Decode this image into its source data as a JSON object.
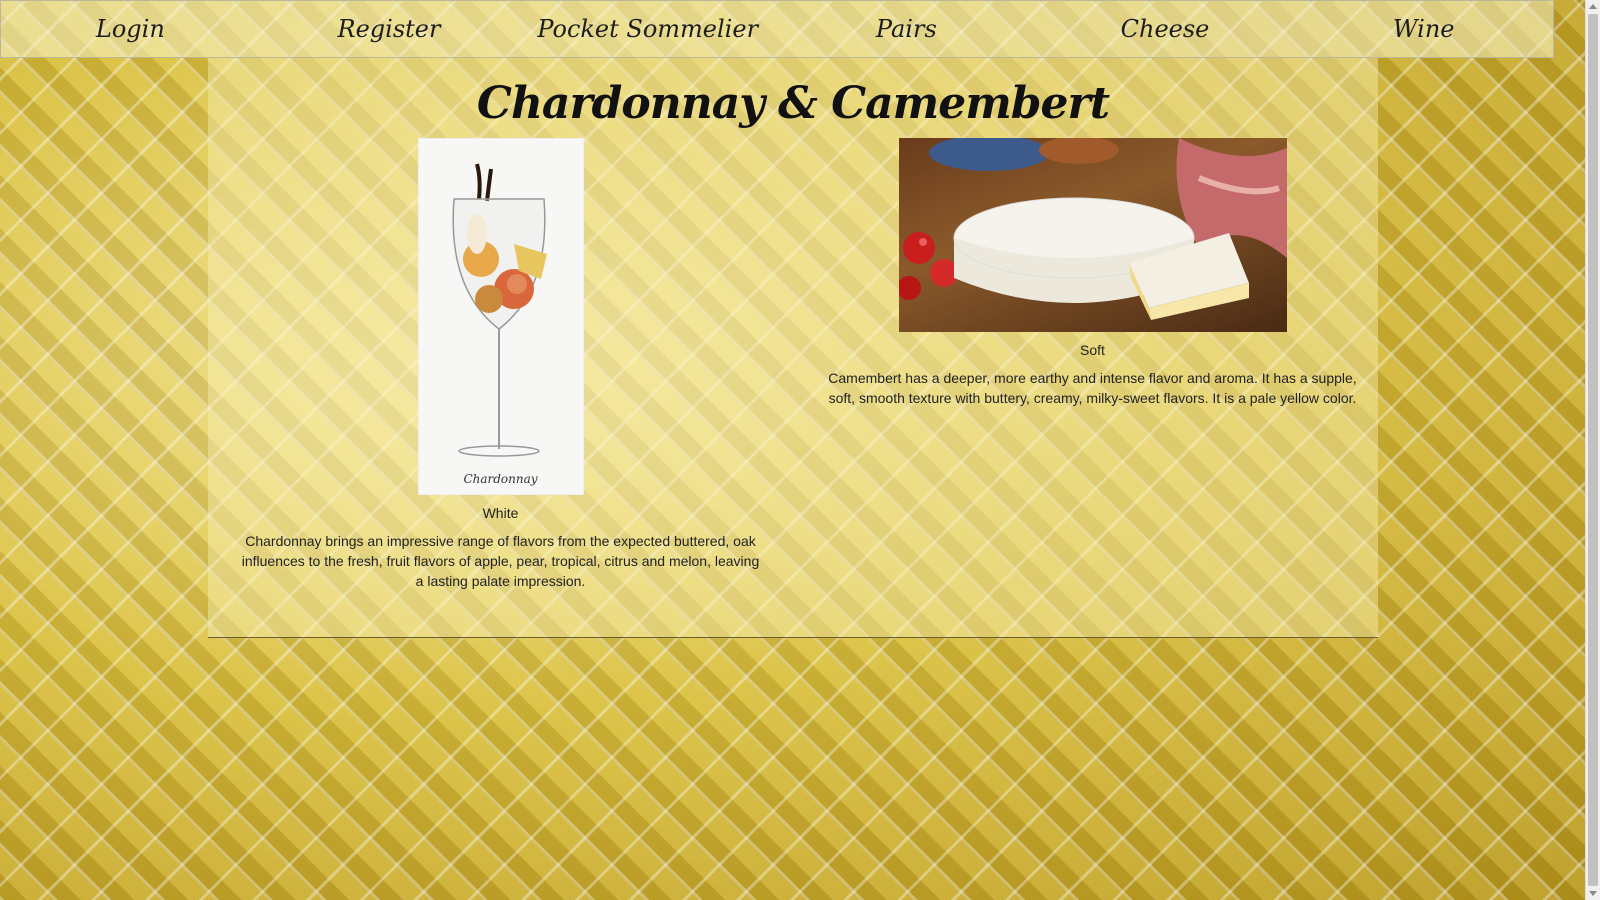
{
  "nav": {
    "items": [
      {
        "label": "Login"
      },
      {
        "label": "Register"
      },
      {
        "label": "Pocket Sommelier"
      },
      {
        "label": "Pairs"
      },
      {
        "label": "Cheese"
      },
      {
        "label": "Wine"
      }
    ]
  },
  "page": {
    "title": "Chardonnay & Camembert"
  },
  "wine": {
    "image_label": "Chardonnay",
    "type": "White",
    "description": "Chardonnay brings an impressive range of flavors from the expected buttered, oak influences to the fresh, fruit flavors of apple, pear, tropical, citrus and melon, leaving a lasting palate impression."
  },
  "cheese": {
    "type": "Soft",
    "description": "Camembert has a deeper, more earthy and intense flavor and aroma. It has a supple, soft, smooth texture with buttery, creamy, milky-sweet flavors. It is a pale yellow color."
  }
}
